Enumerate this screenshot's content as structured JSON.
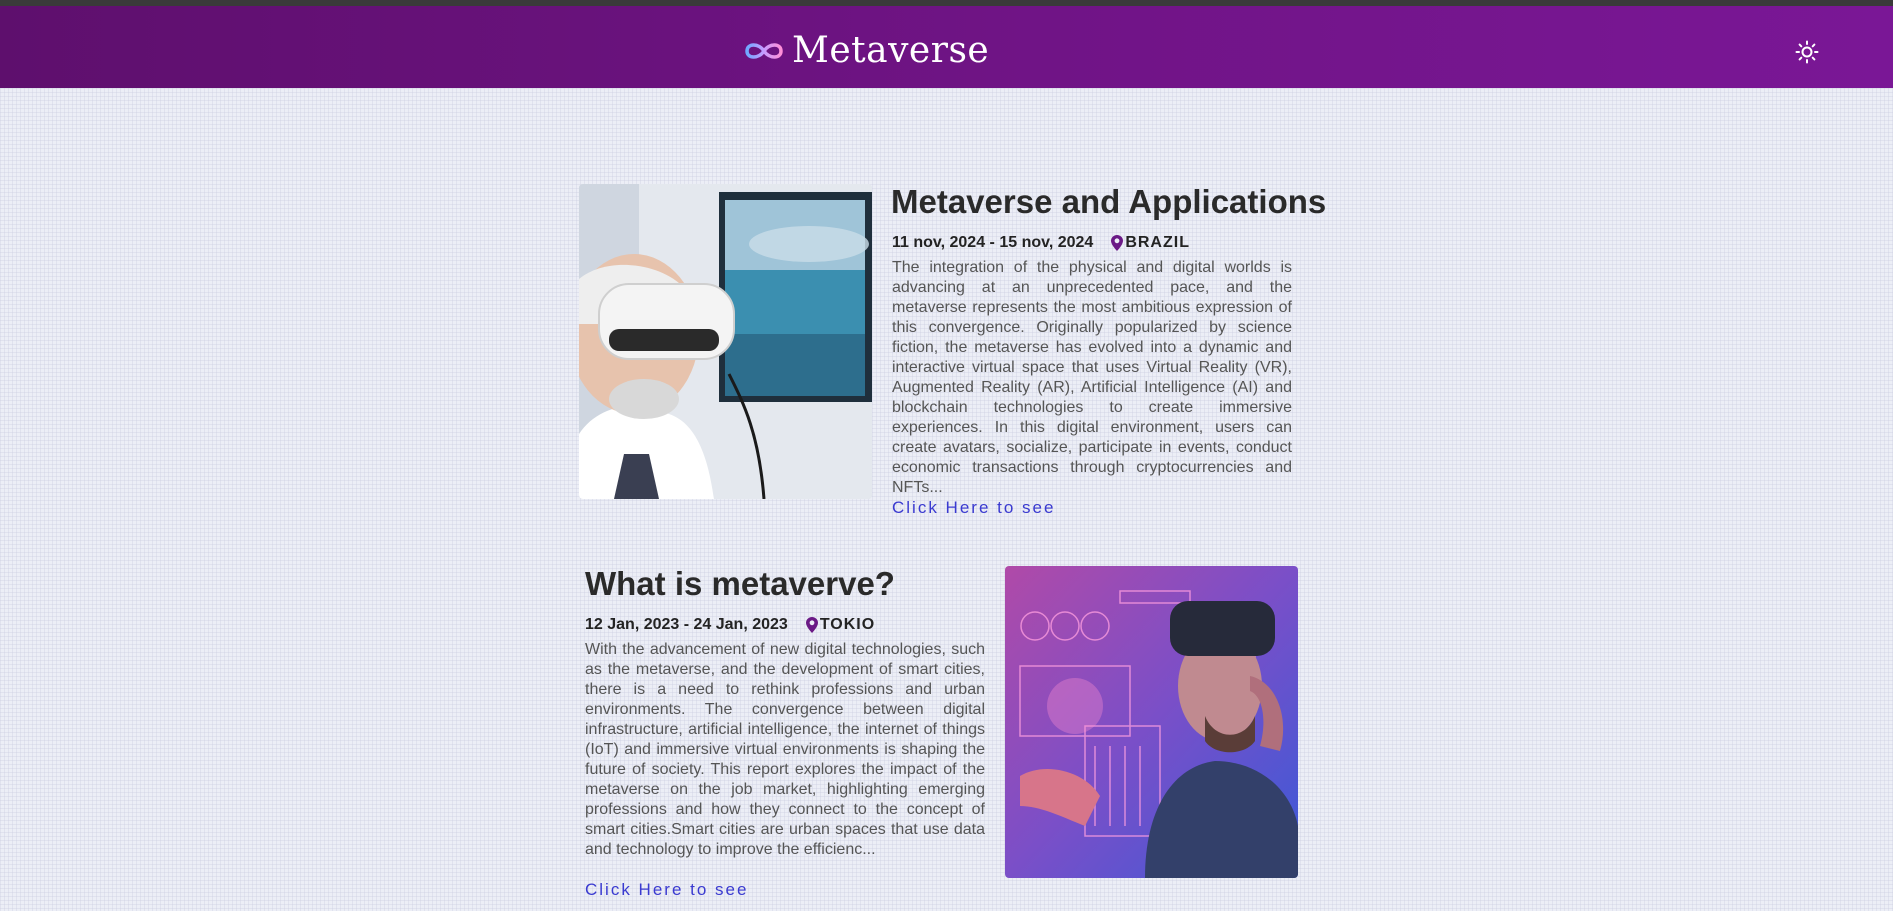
{
  "header": {
    "brand": "Metaverse",
    "logo_icon": "infinity-icon",
    "theme_toggle_icon": "sun-icon"
  },
  "colors": {
    "header_start": "#5e0f6d",
    "header_end": "#7a1796",
    "link": "#3a3ad0",
    "accent_pin": "#6b1a86"
  },
  "events": [
    {
      "title": "Metaverse and Applications",
      "dates": "11 nov, 2024 - 15 nov, 2024",
      "location": "BRAZIL",
      "location_icon": "map-pin-icon",
      "description": "The integration of the physical and digital worlds is advancing at an unprecedented pace, and the metaverse represents the most ambitious expression of this convergence. Originally popularized by science fiction, the metaverse has evolved into a dynamic and interactive virtual space that uses Virtual Reality (VR), Augmented Reality (AR), Artificial Intelligence (AI) and blockchain technologies to create immersive experiences. In this digital environment, users can create avatars, socialize, participate in events, conduct economic transactions through cryptocurrencies and NFTs...",
      "link": "Click Here to see",
      "image": "man-with-vr-headset-photo"
    },
    {
      "title": "What is metaverve?",
      "dates": "12 Jan, 2023 - 24 Jan, 2023",
      "location": "TOKIO",
      "location_icon": "map-pin-icon",
      "description": "With the advancement of new digital technologies, such as the metaverse, and the development of smart cities, there is a need to rethink professions and urban environments. The convergence between digital infrastructure, artificial intelligence, the internet of things (IoT) and immersive virtual environments is shaping the future of society. This report explores the impact of the metaverse on the job market, highlighting emerging professions and how they connect to the concept of smart cities.Smart cities are urban spaces that use data and technology to improve the efficienc...",
      "link": "Click Here to see",
      "image": "futuristic-vr-interface-photo"
    }
  ]
}
